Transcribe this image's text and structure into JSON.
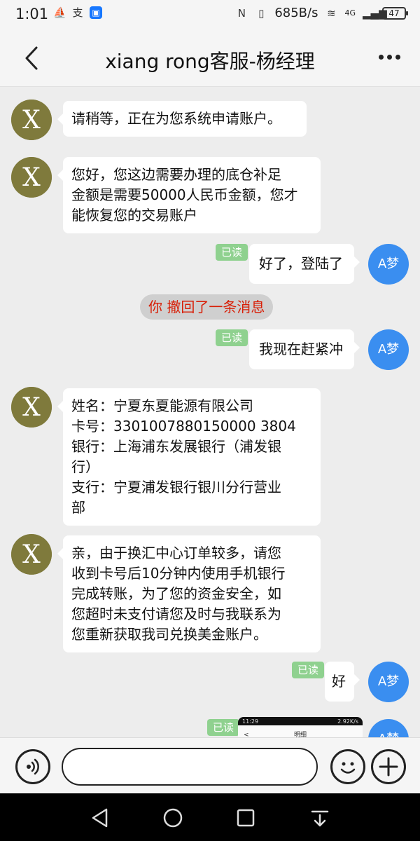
{
  "status_bar": {
    "time": "1:01",
    "network_speed": "685B/s",
    "signal": "4G",
    "battery": "47",
    "left_icons": [
      "boat-icon",
      "alipay-icon",
      "app-icon"
    ]
  },
  "header": {
    "title": "xiang rong客服-杨经理",
    "back_icon": "chevron-left-icon",
    "more_icon": "more-horizontal-icon"
  },
  "messages": {
    "m1": "请稍等，正在为您系统申请账户。",
    "m2_line1": "您好，您这边需要办理的底仓补足",
    "m2_line2": "金额是需要50000人民币金额，您才",
    "m2_line3": "能恢复您的交易账户",
    "m3": "好了，登陆了",
    "recall": "你 撤回了一条消息",
    "m4": "我现在赶紧冲",
    "m5_line1": "姓名：宁夏东夏能源有限公司",
    "m5_line2": "卡号：3301007880150000 3804",
    "m5_line3": "银行：上海浦东发展银行（浦发银",
    "m5_line4": "行）",
    "m5_line5": "支行：宁夏浦发银行银川分行营业",
    "m5_line6": "部",
    "m6_line1": "亲，由于换汇中心订单较多，请您",
    "m6_line2": "收到卡号后10分钟内使用手机银行",
    "m6_line3": "完成转账，为了您的资金安全，如",
    "m6_line4": "您超时未支付请您及时与我联系为",
    "m6_line5": "您重新获取我司兑换美金账户。",
    "m7": "好",
    "read_label": "已读",
    "user_avatar": "A梦",
    "agent_avatar_letter": "X",
    "thumb_time": "11:29",
    "thumb_status_right": "2.92K/s",
    "thumb_title": "明细",
    "thumb_back": "<"
  },
  "input_bar": {
    "placeholder": "",
    "voice_icon": "voice-icon",
    "emoji_icon": "emoji-icon",
    "plus_icon": "plus-icon"
  },
  "nav_bar": {
    "icons": [
      "back-triangle-icon",
      "home-circle-icon",
      "recents-square-icon",
      "notification-down-icon"
    ]
  },
  "colors": {
    "read_badge": "#8fd18f",
    "user_avatar": "#3a8ef0",
    "agent_avatar": "#7f7a3c",
    "recall_text": "#d81e06",
    "background": "#ededed"
  }
}
